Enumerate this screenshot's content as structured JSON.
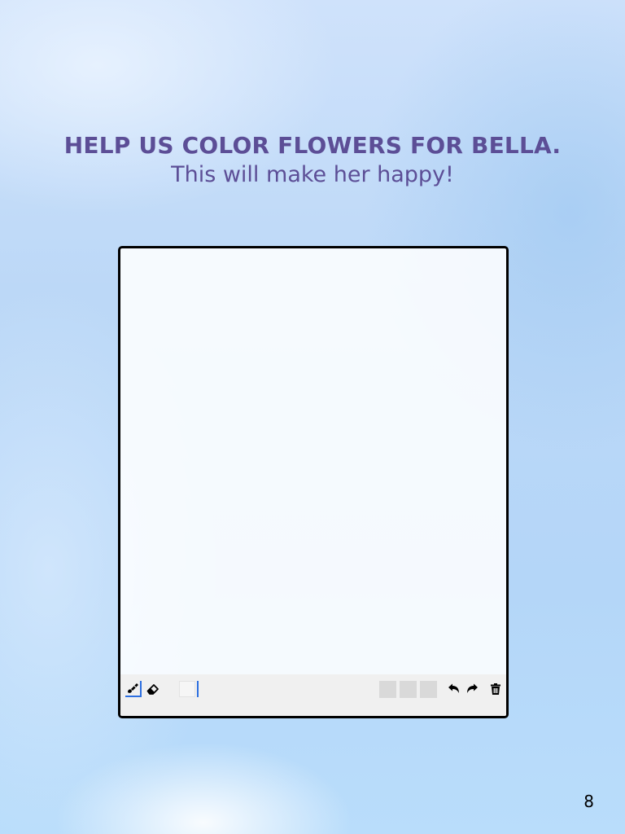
{
  "header": {
    "title": "HELP US COLOR FLOWERS FOR BELLA.",
    "subtitle": "This will make her happy!"
  },
  "toolbar": {
    "tools": [
      {
        "name": "brush",
        "icon": "paint-brush-icon",
        "active": true
      },
      {
        "name": "eraser",
        "icon": "eraser-icon",
        "active": false
      }
    ],
    "color_value": "#f6f6f6",
    "brush_sizes": [
      "small",
      "medium",
      "large"
    ],
    "actions": [
      {
        "name": "undo",
        "icon": "undo-icon"
      },
      {
        "name": "redo",
        "icon": "redo-icon"
      },
      {
        "name": "clear",
        "icon": "trash-icon"
      }
    ]
  },
  "colors": {
    "heading": "#5c4e96",
    "active_tool": "#2d6fe0",
    "toolbar_bg": "#f0f0f0"
  },
  "footer": {
    "page_number": "8"
  }
}
